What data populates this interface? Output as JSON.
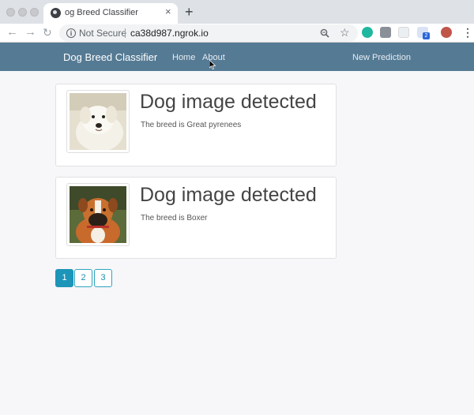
{
  "browser": {
    "tab_title": "og Breed Classifier",
    "new_tab_symbol": "+",
    "close_symbol": "×",
    "security_label": "Not Secure",
    "url": "ca38d987.ngrok.io",
    "extension_badge": "2"
  },
  "navbar": {
    "brand": "Dog Breed Classifier",
    "links": [
      "Home",
      "About"
    ],
    "right_link": "New Prediction",
    "color": "#557a94"
  },
  "results": [
    {
      "title": "Dog image detected",
      "text": "The breed is Great pyrenees",
      "image_icon": "white-dog-photo"
    },
    {
      "title": "Dog image detected",
      "text": "The breed is Boxer",
      "image_icon": "boxer-dog-photo"
    }
  ],
  "pagination": {
    "pages": [
      "1",
      "2",
      "3"
    ],
    "active": "1",
    "accent": "#1d95b8"
  }
}
